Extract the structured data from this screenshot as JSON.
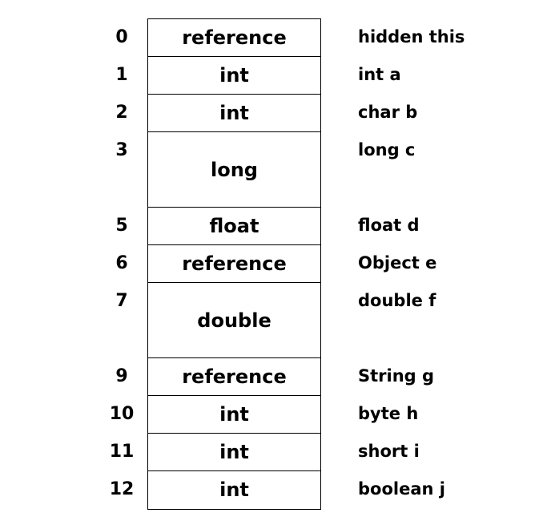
{
  "slots": [
    {
      "index": "0",
      "type": "reference",
      "variable": "hidden this",
      "span": 1
    },
    {
      "index": "1",
      "type": "int",
      "variable": "int a",
      "span": 1
    },
    {
      "index": "2",
      "type": "int",
      "variable": "char b",
      "span": 1
    },
    {
      "index": "3",
      "type": "long",
      "variable": "long c",
      "span": 2
    },
    {
      "index": "5",
      "type": "float",
      "variable": "float d",
      "span": 1
    },
    {
      "index": "6",
      "type": "reference",
      "variable": "Object e",
      "span": 1
    },
    {
      "index": "7",
      "type": "double",
      "variable": "double f",
      "span": 2
    },
    {
      "index": "9",
      "type": "reference",
      "variable": "String g",
      "span": 1
    },
    {
      "index": "10",
      "type": "int",
      "variable": "byte h",
      "span": 1
    },
    {
      "index": "11",
      "type": "int",
      "variable": "short i",
      "span": 1
    },
    {
      "index": "12",
      "type": "int",
      "variable": "boolean j",
      "span": 1
    }
  ]
}
